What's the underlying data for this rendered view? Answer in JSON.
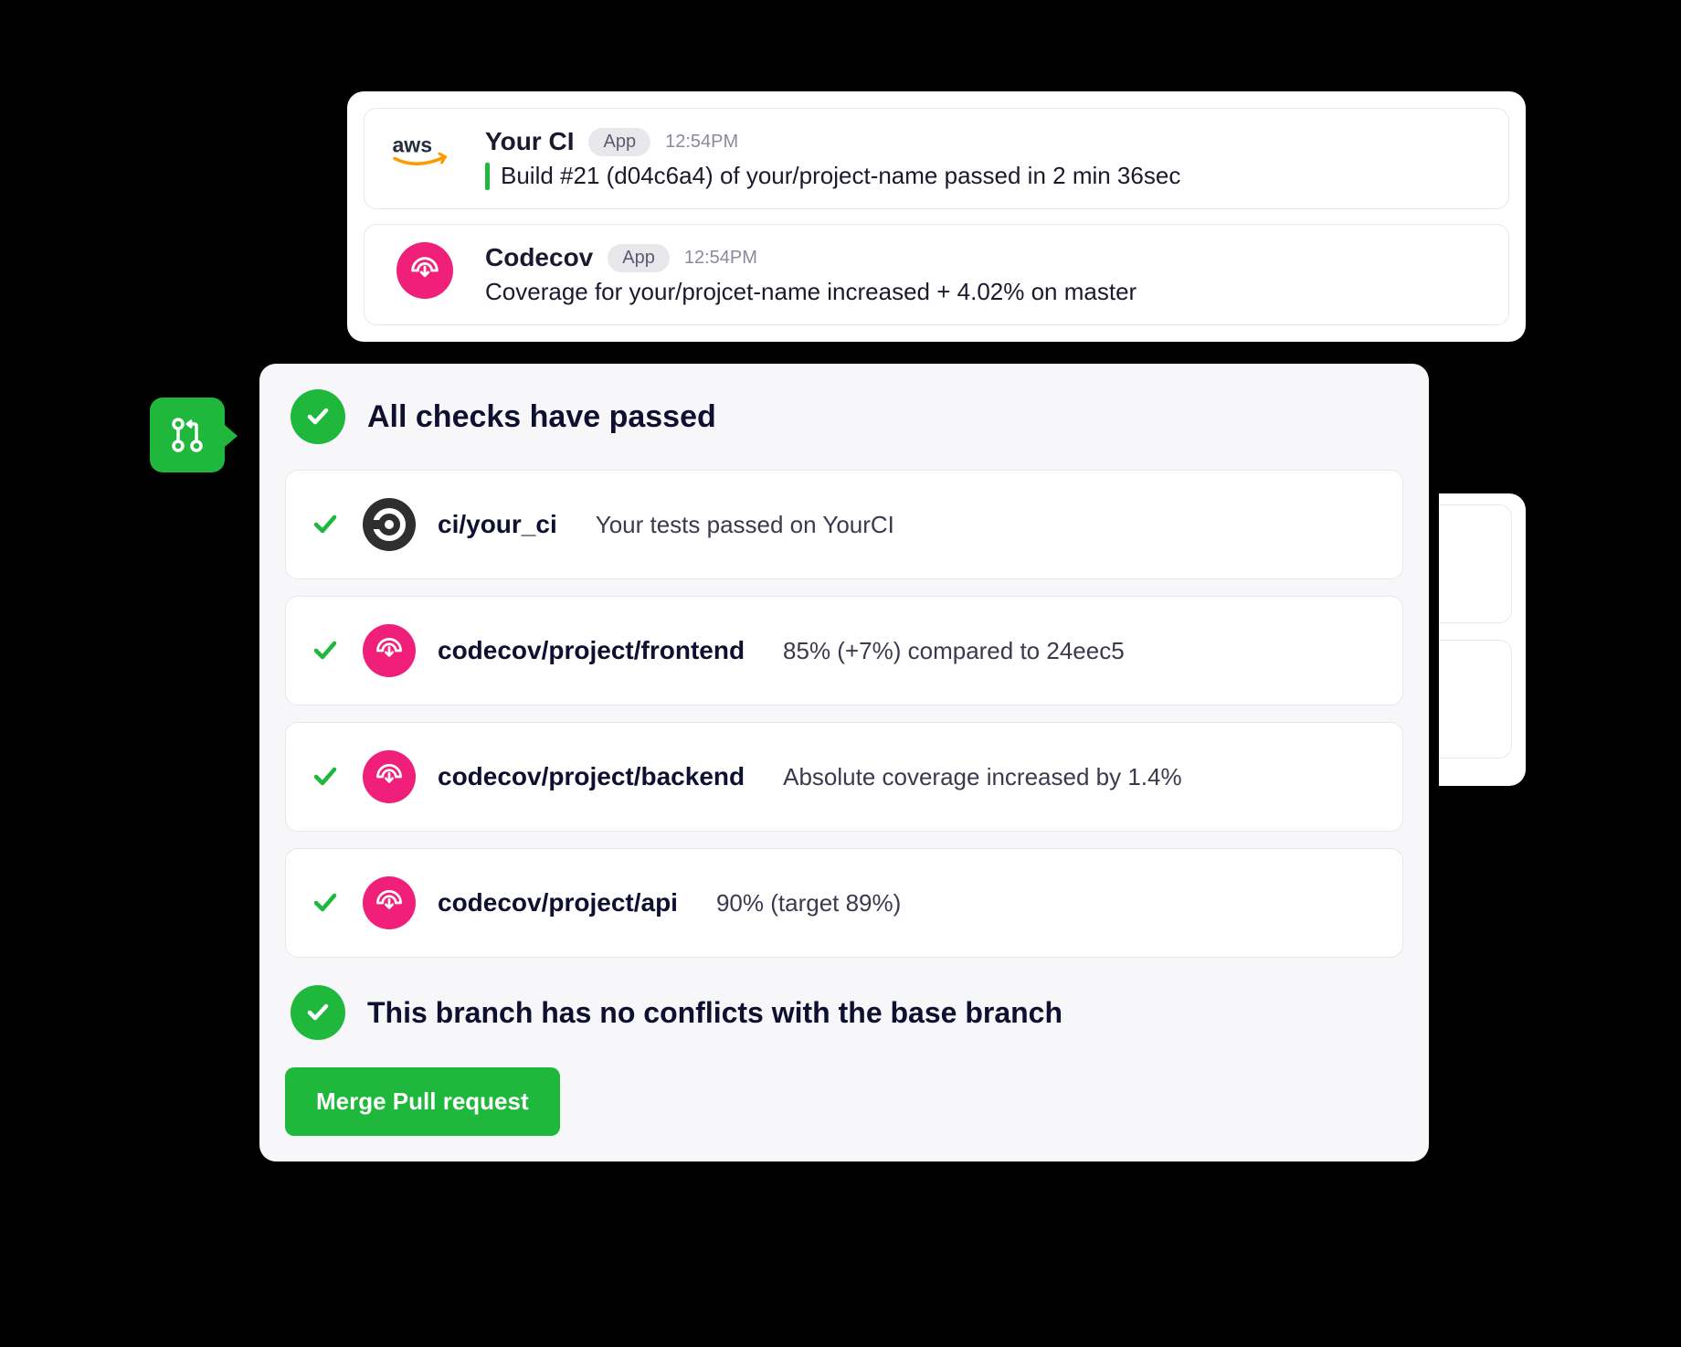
{
  "notifications": [
    {
      "title": "Your CI",
      "badge": "App",
      "time": "12:54PM",
      "message": "Build #21 (d04c6a4) of your/project-name passed in 2 min 36sec",
      "has_bar": true,
      "logo": "aws"
    },
    {
      "title": "Codecov",
      "badge": "App",
      "time": "12:54PM",
      "message": "Coverage for your/projcet-name increased + 4.02% on master",
      "has_bar": false,
      "logo": "codecov"
    }
  ],
  "checks": {
    "header": "All checks have passed",
    "items": [
      {
        "name": "ci/your_ci",
        "desc": "Your tests passed on YourCI",
        "logo": "circleci"
      },
      {
        "name": "codecov/project/frontend",
        "desc": "85% (+7%) compared to 24eec5",
        "logo": "codecov"
      },
      {
        "name": "codecov/project/backend",
        "desc": "Absolute coverage increased by 1.4%",
        "logo": "codecov"
      },
      {
        "name": "codecov/project/api",
        "desc": "90% (target 89%)",
        "logo": "codecov"
      }
    ],
    "conflicts_text": "This branch has no conflicts with the base branch",
    "merge_button": "Merge Pull request"
  }
}
